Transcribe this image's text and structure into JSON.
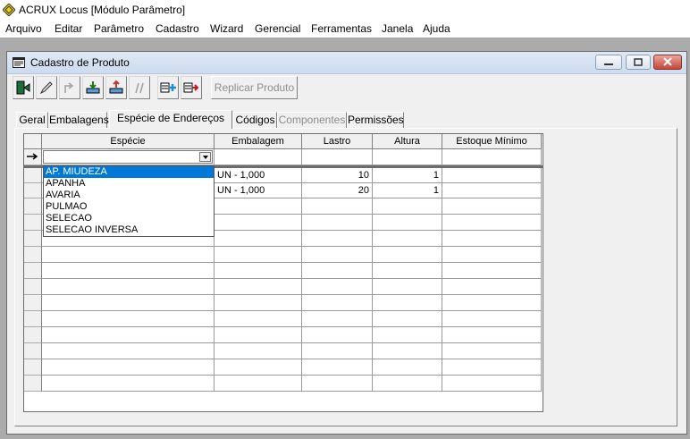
{
  "app": {
    "title": "ACRUX Locus [Módulo Parâmetro]"
  },
  "menu": [
    {
      "label": "Arquivo"
    },
    {
      "label": "Editar"
    },
    {
      "label": "Parâmetro"
    },
    {
      "label": "Cadastro"
    },
    {
      "label": "Wizard"
    },
    {
      "label": "Gerencial"
    },
    {
      "label": "Ferramentas"
    },
    {
      "label": "Janela"
    },
    {
      "label": "Ajuda"
    }
  ],
  "window": {
    "title": "Cadastro de Produto"
  },
  "toolbar": {
    "replicar_label": "Replicar Produto"
  },
  "tabs": [
    {
      "label": "Geral",
      "state": "normal"
    },
    {
      "label": "Embalagens",
      "state": "normal"
    },
    {
      "label": "Espécie de Endereços",
      "state": "active"
    },
    {
      "label": "Códigos",
      "state": "normal"
    },
    {
      "label": "Componentes",
      "state": "disabled"
    },
    {
      "label": "Permissões",
      "state": "normal"
    }
  ],
  "grid": {
    "columns": [
      "Espécie",
      "Embalagem",
      "Lastro",
      "Altura",
      "Estoque Mínimo"
    ],
    "rows": [
      {
        "especie": "",
        "embalagem": "UN - 1,000",
        "lastro": "10",
        "altura": "1",
        "estoque_minimo": ""
      },
      {
        "especie": "",
        "embalagem": "UN - 1,000",
        "lastro": "20",
        "altura": "1",
        "estoque_minimo": ""
      }
    ],
    "empty_rows": 12
  },
  "especie_dropdown": {
    "options": [
      "AP. MIUDEZA",
      "APANHA",
      "AVARIA",
      "PULMAO",
      "SELECAO",
      "SELECAO INVERSA"
    ],
    "selected": "AP. MIUDEZA"
  },
  "colors": {
    "mdi_background": "#ababab",
    "selection": "#0078d7",
    "title_gradient": "#cddbee"
  }
}
